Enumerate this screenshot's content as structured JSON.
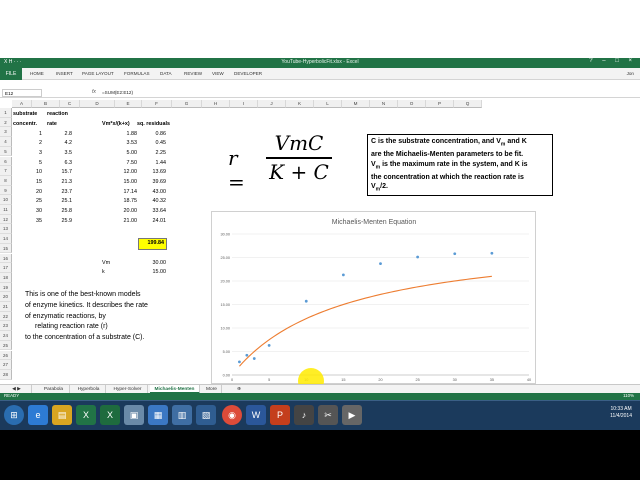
{
  "window": {
    "title": "YouTube-HyperbolicFit.xlsx - Excel",
    "quick_access": "X  H  ·  ·  ·",
    "controls": "?  –  □  ×"
  },
  "ribbon": {
    "file_label": "FILE",
    "tabs": [
      "HOME",
      "INSERT",
      "PAGE LAYOUT",
      "FORMULAS",
      "DATA",
      "REVIEW",
      "VIEW",
      "DEVELOPER"
    ],
    "user": "Jon"
  },
  "formula_bar": {
    "name_box": "E12",
    "fx": "fx",
    "formula": "=SUM(E2:E12)"
  },
  "columns": [
    "A",
    "B",
    "C",
    "D",
    "E",
    "F",
    "G",
    "H",
    "I",
    "J",
    "K",
    "L",
    "M",
    "N",
    "O",
    "P",
    "Q"
  ],
  "rows": [
    "1",
    "2",
    "3",
    "4",
    "5",
    "6",
    "7",
    "8",
    "9",
    "10",
    "11",
    "12",
    "13",
    "14",
    "15",
    "16",
    "17",
    "18",
    "19",
    "20",
    "21",
    "22",
    "23",
    "24",
    "25",
    "26",
    "27",
    "28"
  ],
  "headers": {
    "substrate_1": "substrate",
    "substrate_2": "concentr.",
    "rate_1": "reaction",
    "rate_2": "rate",
    "model": "Vm*x/(k+x)",
    "residuals": "sq. residuals"
  },
  "table": [
    {
      "c": "1",
      "r": "2.8",
      "m": "1.88",
      "s": "0.86"
    },
    {
      "c": "2",
      "r": "4.2",
      "m": "3.53",
      "s": "0.45"
    },
    {
      "c": "3",
      "r": "3.5",
      "m": "5.00",
      "s": "2.25"
    },
    {
      "c": "5",
      "r": "6.3",
      "m": "7.50",
      "s": "1.44"
    },
    {
      "c": "10",
      "r": "15.7",
      "m": "12.00",
      "s": "13.69"
    },
    {
      "c": "15",
      "r": "21.3",
      "m": "15.00",
      "s": "39.69"
    },
    {
      "c": "20",
      "r": "23.7",
      "m": "17.14",
      "s": "43.00"
    },
    {
      "c": "25",
      "r": "25.1",
      "m": "18.75",
      "s": "40.32"
    },
    {
      "c": "30",
      "r": "25.8",
      "m": "20.00",
      "s": "33.64"
    },
    {
      "c": "35",
      "r": "25.9",
      "m": "21.00",
      "s": "24.01"
    }
  ],
  "sum_value": "199.84",
  "params": {
    "vm_label": "Vm",
    "vm_value": "30.00",
    "k_label": "k",
    "k_value": "15.00"
  },
  "equation": {
    "lhs": "r =",
    "numerator": "VmC",
    "denominator": "K + C"
  },
  "note": {
    "line1": "C is the substrate concentration, and V",
    "line1_sub": "m",
    "line1_end": " and K",
    "line2": "are the Michaelis-Menten parameters to be fit.",
    "line3": "V",
    "line3_sub": "m",
    "line3_end": " is the maximum rate in the system, and K is",
    "line4": "the concentration at which the reaction rate is",
    "line5": "V",
    "line5_sub": "m",
    "line5_end": "/2."
  },
  "description": [
    "This is one of the best-known models",
    "of enzyme kinetics. It describes the rate",
    "of enzymatic reactions, by",
    "relating reaction rate  (r)",
    "to the concentration of a substrate (C)."
  ],
  "chart_data": {
    "type": "scatter",
    "title": "Michaelis-Menten Equation",
    "xlim": [
      0,
      40
    ],
    "ylim": [
      0,
      30
    ],
    "x_ticks": [
      "0",
      "5",
      "10",
      "15",
      "20",
      "25",
      "30",
      "35",
      "40"
    ],
    "y_ticks": [
      "0.00",
      "5.00",
      "10.00",
      "15.00",
      "20.00",
      "25.00",
      "30.00"
    ],
    "series": [
      {
        "kind": "points",
        "x": [
          1,
          2,
          3,
          5,
          10,
          15,
          20,
          25,
          30,
          35
        ],
        "y": [
          2.8,
          4.2,
          3.5,
          6.3,
          15.7,
          21.3,
          23.7,
          25.1,
          25.8,
          25.9
        ],
        "color": "#5b9bd5"
      },
      {
        "kind": "curve",
        "vm": 30,
        "k": 15,
        "x_range": [
          1,
          35
        ],
        "color": "#ed7d31"
      }
    ]
  },
  "sheet_tabs": [
    "Parabola",
    "Hyperbola",
    "Hyper-Solver",
    "Michaelis-Menten",
    "More"
  ],
  "active_sheet": "Michaelis-Menten",
  "status": {
    "left": "READY",
    "zoom": "110%"
  },
  "clock": {
    "time": "10:33 AM",
    "date": "11/4/2014"
  },
  "taskbar_icons": [
    "start-orb",
    "ie",
    "explorer",
    "excel",
    "excel-2",
    "chrome",
    "word",
    "powerpoint",
    "media",
    "snipping",
    "video"
  ]
}
